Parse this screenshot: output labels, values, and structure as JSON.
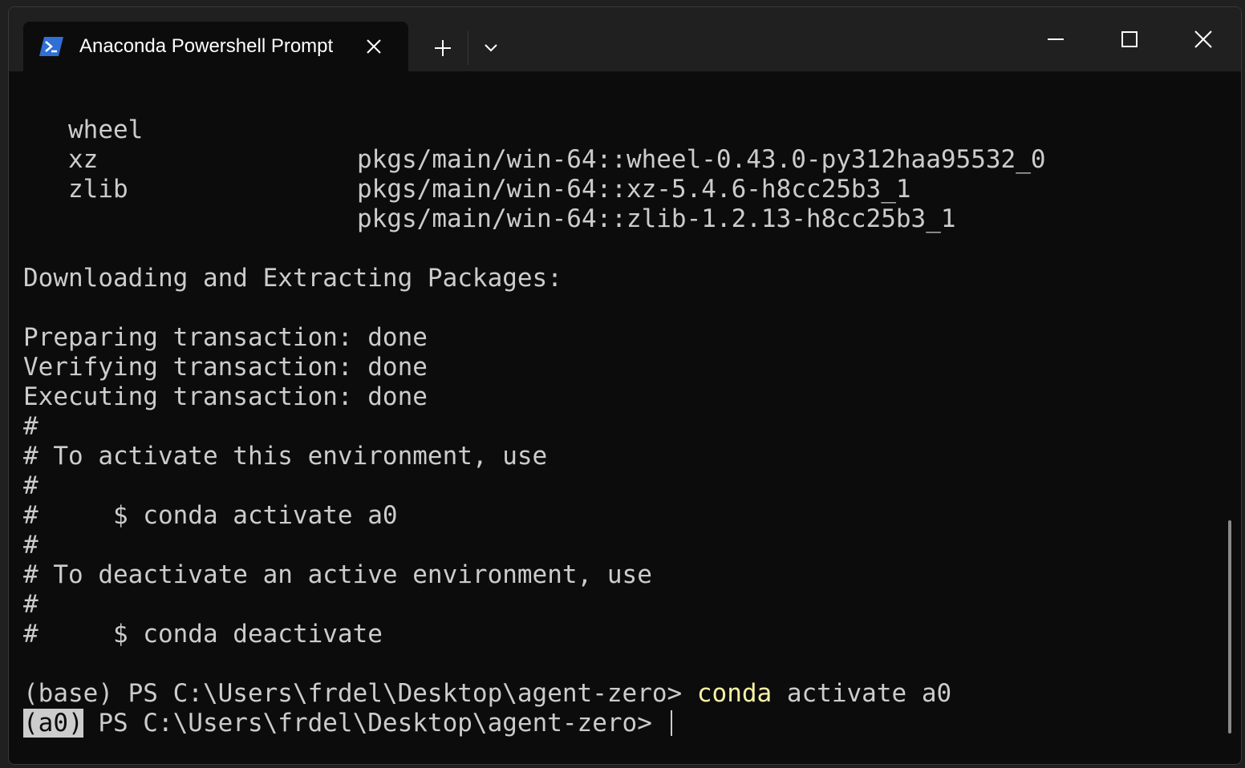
{
  "window": {
    "tab_title": "Anaconda Powershell Prompt",
    "icons": {
      "tab": "powershell-icon",
      "close_tab": "close-icon",
      "new_tab": "plus-icon",
      "dropdown": "chevron-down-icon",
      "minimize": "minimize-icon",
      "maximize": "maximize-icon",
      "close_window": "close-icon"
    }
  },
  "terminal": {
    "packages": [
      {
        "name": "wheel",
        "source": "pkgs/main/win-64::wheel-0.43.0-py312haa95532_0"
      },
      {
        "name": "xz",
        "source": "pkgs/main/win-64::xz-5.4.6-h8cc25b3_1"
      },
      {
        "name": "zlib",
        "source": "pkgs/main/win-64::zlib-1.2.13-h8cc25b3_1"
      }
    ],
    "lines": [
      "Downloading and Extracting Packages:",
      "",
      "Preparing transaction: done",
      "Verifying transaction: done",
      "Executing transaction: done",
      "#",
      "# To activate this environment, use",
      "#",
      "#     $ conda activate a0",
      "#",
      "# To deactivate an active environment, use",
      "#",
      "#     $ conda deactivate"
    ],
    "prompt1": {
      "prefix": "(base) PS C:\\Users\\frdel\\Desktop\\agent-zero> ",
      "command": "conda",
      "args": " activate a0"
    },
    "prompt2": {
      "env": "(a0)",
      "prefix": " PS C:\\Users\\frdel\\Desktop\\agent-zero> "
    }
  },
  "colors": {
    "background": "#0c0c0c",
    "foreground": "#cccccc",
    "command_highlight": "#f9f1a5",
    "titlebar": "#202020"
  }
}
